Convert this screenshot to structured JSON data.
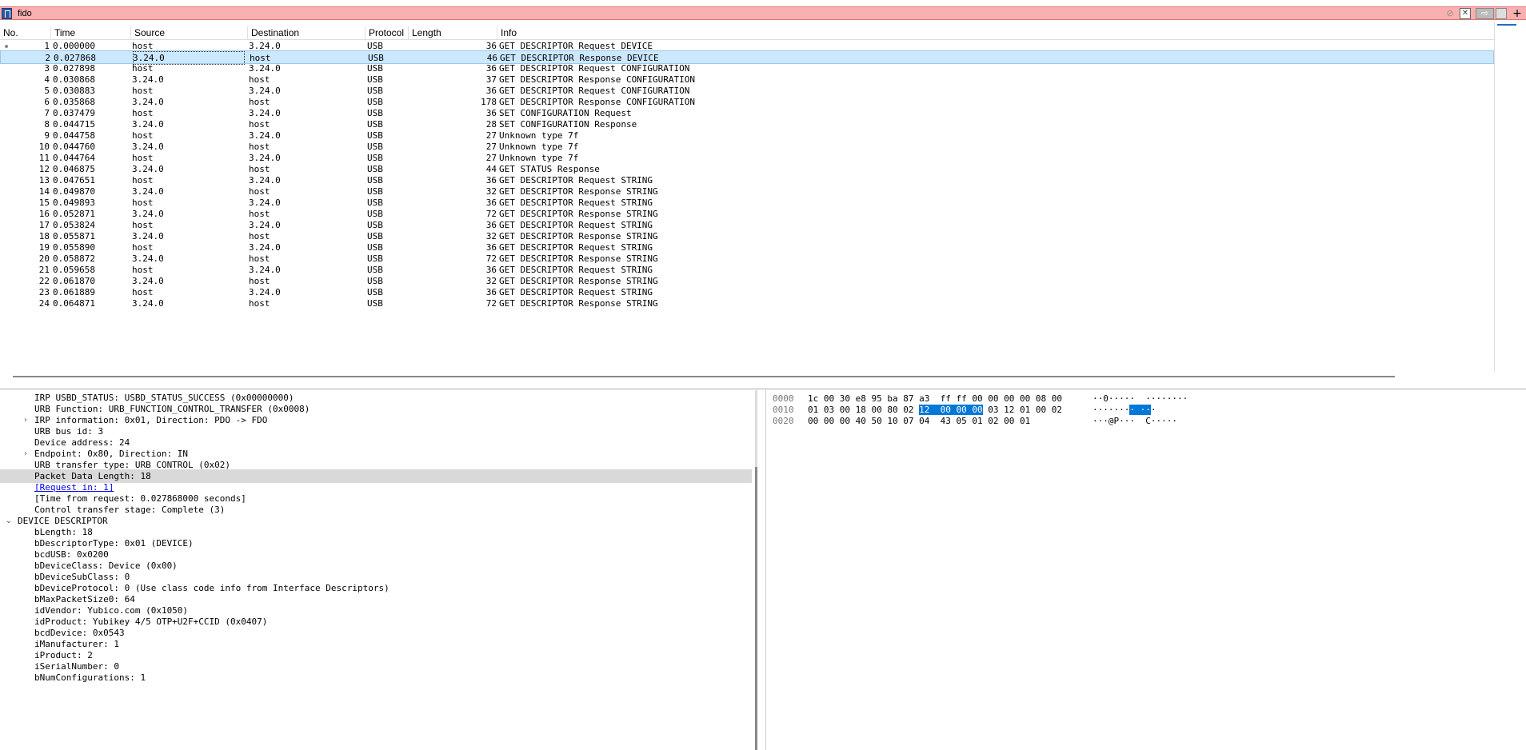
{
  "filter": {
    "value": "fido",
    "icons": [
      "bookmark-icon",
      "clear-icon",
      "close-icon",
      "apply-arrow-icon",
      "dropdown-icon",
      "plus-icon"
    ]
  },
  "packet_list": {
    "columns": [
      "No.",
      "Time",
      "Source",
      "Destination",
      "Protocol",
      "Length",
      "Info"
    ],
    "rows": [
      {
        "no": "1",
        "time": "0.000000",
        "src": "host",
        "dst": "3.24.0",
        "proto": "USB",
        "len": "36",
        "info": "GET DESCRIPTOR Request DEVICE"
      },
      {
        "no": "2",
        "time": "0.027868",
        "src": "3.24.0",
        "dst": "host",
        "proto": "USB",
        "len": "46",
        "info": "GET DESCRIPTOR Response DEVICE"
      },
      {
        "no": "3",
        "time": "0.027898",
        "src": "host",
        "dst": "3.24.0",
        "proto": "USB",
        "len": "36",
        "info": "GET DESCRIPTOR Request CONFIGURATION"
      },
      {
        "no": "4",
        "time": "0.030868",
        "src": "3.24.0",
        "dst": "host",
        "proto": "USB",
        "len": "37",
        "info": "GET DESCRIPTOR Response CONFIGURATION"
      },
      {
        "no": "5",
        "time": "0.030883",
        "src": "host",
        "dst": "3.24.0",
        "proto": "USB",
        "len": "36",
        "info": "GET DESCRIPTOR Request CONFIGURATION"
      },
      {
        "no": "6",
        "time": "0.035868",
        "src": "3.24.0",
        "dst": "host",
        "proto": "USB",
        "len": "178",
        "info": "GET DESCRIPTOR Response CONFIGURATION"
      },
      {
        "no": "7",
        "time": "0.037479",
        "src": "host",
        "dst": "3.24.0",
        "proto": "USB",
        "len": "36",
        "info": "SET CONFIGURATION Request"
      },
      {
        "no": "8",
        "time": "0.044715",
        "src": "3.24.0",
        "dst": "host",
        "proto": "USB",
        "len": "28",
        "info": "SET CONFIGURATION Response"
      },
      {
        "no": "9",
        "time": "0.044758",
        "src": "host",
        "dst": "3.24.0",
        "proto": "USB",
        "len": "27",
        "info": "Unknown type 7f"
      },
      {
        "no": "10",
        "time": "0.044760",
        "src": "3.24.0",
        "dst": "host",
        "proto": "USB",
        "len": "27",
        "info": "Unknown type 7f"
      },
      {
        "no": "11",
        "time": "0.044764",
        "src": "host",
        "dst": "3.24.0",
        "proto": "USB",
        "len": "27",
        "info": "Unknown type 7f"
      },
      {
        "no": "12",
        "time": "0.046875",
        "src": "3.24.0",
        "dst": "host",
        "proto": "USB",
        "len": "44",
        "info": "GET STATUS Response"
      },
      {
        "no": "13",
        "time": "0.047651",
        "src": "host",
        "dst": "3.24.0",
        "proto": "USB",
        "len": "36",
        "info": "GET DESCRIPTOR Request STRING"
      },
      {
        "no": "14",
        "time": "0.049870",
        "src": "3.24.0",
        "dst": "host",
        "proto": "USB",
        "len": "32",
        "info": "GET DESCRIPTOR Response STRING"
      },
      {
        "no": "15",
        "time": "0.049893",
        "src": "host",
        "dst": "3.24.0",
        "proto": "USB",
        "len": "36",
        "info": "GET DESCRIPTOR Request STRING"
      },
      {
        "no": "16",
        "time": "0.052871",
        "src": "3.24.0",
        "dst": "host",
        "proto": "USB",
        "len": "72",
        "info": "GET DESCRIPTOR Response STRING"
      },
      {
        "no": "17",
        "time": "0.053824",
        "src": "host",
        "dst": "3.24.0",
        "proto": "USB",
        "len": "36",
        "info": "GET DESCRIPTOR Request STRING"
      },
      {
        "no": "18",
        "time": "0.055871",
        "src": "3.24.0",
        "dst": "host",
        "proto": "USB",
        "len": "32",
        "info": "GET DESCRIPTOR Response STRING"
      },
      {
        "no": "19",
        "time": "0.055890",
        "src": "host",
        "dst": "3.24.0",
        "proto": "USB",
        "len": "36",
        "info": "GET DESCRIPTOR Request STRING"
      },
      {
        "no": "20",
        "time": "0.058872",
        "src": "3.24.0",
        "dst": "host",
        "proto": "USB",
        "len": "72",
        "info": "GET DESCRIPTOR Response STRING"
      },
      {
        "no": "21",
        "time": "0.059658",
        "src": "host",
        "dst": "3.24.0",
        "proto": "USB",
        "len": "36",
        "info": "GET DESCRIPTOR Request STRING"
      },
      {
        "no": "22",
        "time": "0.061870",
        "src": "3.24.0",
        "dst": "host",
        "proto": "USB",
        "len": "32",
        "info": "GET DESCRIPTOR Response STRING"
      },
      {
        "no": "23",
        "time": "0.061889",
        "src": "host",
        "dst": "3.24.0",
        "proto": "USB",
        "len": "36",
        "info": "GET DESCRIPTOR Request STRING"
      },
      {
        "no": "24",
        "time": "0.064871",
        "src": "3.24.0",
        "dst": "host",
        "proto": "USB",
        "len": "72",
        "info": "GET DESCRIPTOR Response STRING"
      }
    ],
    "selected_row": "2"
  },
  "details": [
    {
      "text": "IRP USBD_STATUS: USBD_STATUS_SUCCESS (0x00000000)",
      "indent": 1,
      "arrow": ""
    },
    {
      "text": "URB Function: URB_FUNCTION_CONTROL_TRANSFER (0x0008)",
      "indent": 1,
      "arrow": ""
    },
    {
      "text": "IRP information: 0x01, Direction: PDO -> FDO",
      "indent": 1,
      "arrow": "›"
    },
    {
      "text": "URB bus id: 3",
      "indent": 1,
      "arrow": ""
    },
    {
      "text": "Device address: 24",
      "indent": 1,
      "arrow": ""
    },
    {
      "text": "Endpoint: 0x80, Direction: IN",
      "indent": 1,
      "arrow": "›"
    },
    {
      "text": "URB transfer type: URB_CONTROL (0x02)",
      "indent": 1,
      "arrow": ""
    },
    {
      "text": "Packet Data Length: 18",
      "indent": 1,
      "arrow": "",
      "highlight": true
    },
    {
      "text": "[Request in: 1]",
      "indent": 1,
      "arrow": "",
      "link": true
    },
    {
      "text": "[Time from request: 0.027868000 seconds]",
      "indent": 1,
      "arrow": ""
    },
    {
      "text": "Control transfer stage: Complete (3)",
      "indent": 1,
      "arrow": ""
    },
    {
      "text": "DEVICE DESCRIPTOR",
      "indent": 0,
      "arrow": "⌄"
    },
    {
      "text": "bLength: 18",
      "indent": 1,
      "arrow": ""
    },
    {
      "text": "bDescriptorType: 0x01 (DEVICE)",
      "indent": 1,
      "arrow": ""
    },
    {
      "text": "bcdUSB: 0x0200",
      "indent": 1,
      "arrow": ""
    },
    {
      "text": "bDeviceClass: Device (0x00)",
      "indent": 1,
      "arrow": ""
    },
    {
      "text": "bDeviceSubClass: 0",
      "indent": 1,
      "arrow": ""
    },
    {
      "text": "bDeviceProtocol: 0 (Use class code info from Interface Descriptors)",
      "indent": 1,
      "arrow": ""
    },
    {
      "text": "bMaxPacketSize0: 64",
      "indent": 1,
      "arrow": ""
    },
    {
      "text": "idVendor: Yubico.com (0x1050)",
      "indent": 1,
      "arrow": ""
    },
    {
      "text": "idProduct: Yubikey 4/5 OTP+U2F+CCID (0x0407)",
      "indent": 1,
      "arrow": ""
    },
    {
      "text": "bcdDevice: 0x0543",
      "indent": 1,
      "arrow": ""
    },
    {
      "text": "iManufacturer: 1",
      "indent": 1,
      "arrow": ""
    },
    {
      "text": "iProduct: 2",
      "indent": 1,
      "arrow": ""
    },
    {
      "text": "iSerialNumber: 0",
      "indent": 1,
      "arrow": ""
    },
    {
      "text": "bNumConfigurations: 1",
      "indent": 1,
      "arrow": ""
    }
  ],
  "hex": [
    {
      "offset": "0000",
      "bytes": [
        "1c",
        "00",
        "30",
        "e8",
        "95",
        "ba",
        "87",
        "a3",
        "ff",
        "ff",
        "00",
        "00",
        "00",
        "00",
        "08",
        "00"
      ],
      "ascii": "··0·····  ········",
      "sel": []
    },
    {
      "offset": "0010",
      "bytes": [
        "01",
        "03",
        "00",
        "18",
        "00",
        "80",
        "02",
        "12",
        "00",
        "00",
        "00",
        "03",
        "12",
        "01",
        "00",
        "02"
      ],
      "ascii": "········ ···",
      "sel": [
        7,
        8,
        9,
        10
      ]
    },
    {
      "offset": "0020",
      "bytes": [
        "00",
        "00",
        "00",
        "40",
        "50",
        "10",
        "07",
        "04",
        "43",
        "05",
        "01",
        "02",
        "00",
        "01"
      ],
      "ascii": "···@P···  C·····",
      "sel": []
    }
  ],
  "colors": {
    "filter_bg": "#f9b0b0",
    "selected_row_bg": "#cce8ff",
    "hex_selection": "#0078d7",
    "detail_highlight": "#d9d9d9"
  }
}
